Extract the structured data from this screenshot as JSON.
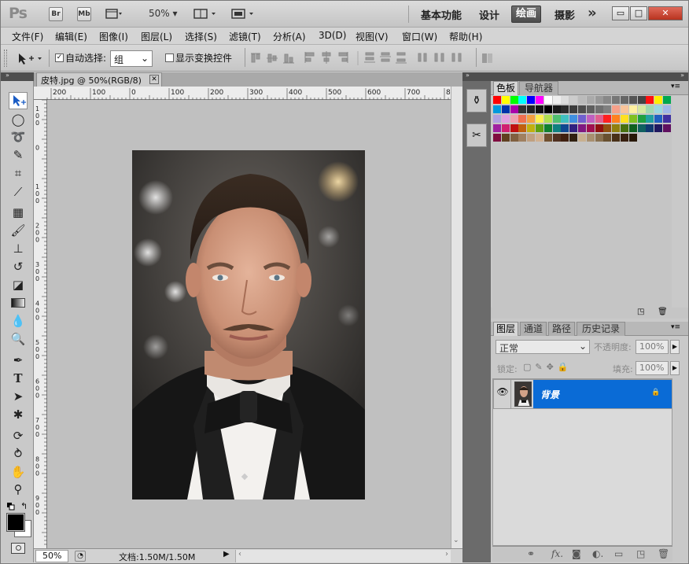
{
  "app": {
    "logo": "Ps"
  },
  "titlebar": {
    "bridge_btn": "Br",
    "minibridge_btn": "Mb",
    "zoom": "50%",
    "workspaces": [
      "基本功能",
      "设计",
      "绘画",
      "摄影"
    ],
    "active_workspace": "绘画",
    "more": "»"
  },
  "menu": {
    "items": [
      "文件(F)",
      "编辑(E)",
      "图像(I)",
      "图层(L)",
      "选择(S)",
      "滤镜(T)",
      "分析(A)",
      "3D(D)",
      "视图(V)",
      "窗口(W)",
      "帮助(H)"
    ]
  },
  "options": {
    "auto_select_label": "自动选择:",
    "auto_select_checked": true,
    "auto_select_value": "组",
    "show_transform_label": "显示变换控件",
    "show_transform_checked": false
  },
  "document": {
    "tab_title": "皮特.jpg @ 50%(RGB/8)",
    "zoom": "50%",
    "doc_info": "文档:1.50M/1.50M",
    "ruler_top_labels": [
      "200",
      "100",
      "0",
      "100",
      "200",
      "300",
      "400",
      "500",
      "600",
      "700",
      "8"
    ],
    "ruler_left_labels": [
      "1\n0\n0",
      "0",
      "1\n0\n0",
      "2\n0\n0",
      "3\n0\n0",
      "4\n0\n0",
      "5\n0\n0",
      "6\n0\n0",
      "7\n0\n0",
      "8\n0\n0",
      "9\n0\n0"
    ]
  },
  "swatches_panel": {
    "tabs": [
      "色板",
      "导航器"
    ],
    "active_tab": "色板"
  },
  "swatch_rows": [
    [
      "#ff0000",
      "#ffff00",
      "#00ff00",
      "#00ffff",
      "#0000ff",
      "#ff00ff",
      "#ffffff",
      "#eeeeee",
      "#dddddd",
      "#cccccc",
      "#bbbbbb",
      "#aaaaaa",
      "#999999",
      "#888888",
      "#777777",
      "#666666",
      "#555555",
      "#444444",
      "#ff1010",
      "#ffee00",
      "#00a84f"
    ],
    [
      "#0099dd",
      "#0033aa",
      "#aa00aa",
      "#333333",
      "#222222",
      "#111111",
      "#000000",
      "#1a1a1a",
      "#2b2b2b",
      "#3c3c3c",
      "#4d4d4d",
      "#5e5e5e",
      "#6f6f6f",
      "#808080",
      "#f6a08a",
      "#f9c49a",
      "#fff0a0",
      "#d6e8a0",
      "#a0d8b0",
      "#9ad8e0",
      "#a0b8e8"
    ],
    [
      "#b0a0e0",
      "#e0a0e0",
      "#f0a0b0",
      "#f07050",
      "#f4a040",
      "#fff050",
      "#b0e050",
      "#50c070",
      "#40c0c0",
      "#4090e0",
      "#7060d0",
      "#c060c0",
      "#e06090",
      "#ff2020",
      "#ff8020",
      "#ffe020",
      "#80c020",
      "#20a040",
      "#20a0a0",
      "#2060c0",
      "#4030a0"
    ],
    [
      "#a020a0",
      "#d02070",
      "#c01010",
      "#c06010",
      "#c0b010",
      "#60a010",
      "#108030",
      "#108080",
      "#104890",
      "#302080",
      "#801880",
      "#a01050",
      "#901010",
      "#905010",
      "#908010",
      "#487010",
      "#106020",
      "#106060",
      "#103870",
      "#201860",
      "#601060"
    ],
    [
      "#800c40",
      "#604020",
      "#806040",
      "#a08060",
      "#c0a080",
      "#d0b090",
      "#705030",
      "#503020",
      "#402010",
      "#302010",
      "#c8b090",
      "#a89070",
      "#887050",
      "#685030",
      "#483018",
      "#382010",
      "#281808"
    ]
  ],
  "layers_panel": {
    "tabs": [
      "图层",
      "通道",
      "路径",
      "历史记录"
    ],
    "active_tab": "图层",
    "blend_mode": "正常",
    "opacity_label": "不透明度:",
    "opacity": "100%",
    "lock_label": "锁定:",
    "fill_label": "填充:",
    "fill": "100%",
    "layers": [
      {
        "name": "背景",
        "visible": true,
        "locked": true,
        "selected": true
      }
    ]
  },
  "colors": {
    "selection": "#0a6bd6",
    "foreground": "#000000",
    "background": "#ffffff"
  }
}
